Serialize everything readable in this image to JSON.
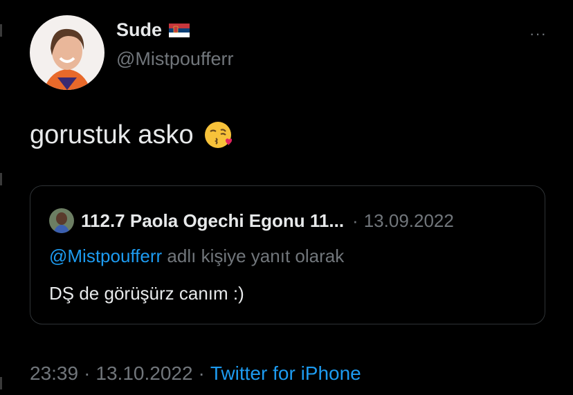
{
  "author": {
    "display_name": "Sude",
    "handle": "@Mistpoufferr",
    "flag_icon": "serbia-flag-icon",
    "more_label": "···"
  },
  "tweet": {
    "text": "gorustuk asko",
    "emoji": "face-blowing-kiss-emoji"
  },
  "quoted_tweet": {
    "author_name": "112.7 Paola Ogechi Egonu 11...",
    "separator": "·",
    "date": "13.09.2022",
    "reply_mention": "@Mistpoufferr",
    "reply_suffix": "adlı kişiye yanıt olarak",
    "text": "DŞ de görüşürz canım :)"
  },
  "meta": {
    "time": "23:39",
    "sep1": "·",
    "date": "13.10.2022",
    "sep2": "·",
    "source": "Twitter for iPhone"
  },
  "colors": {
    "background": "#000000",
    "text": "#e7e9ea",
    "muted": "#71767b",
    "link": "#1d9bf0",
    "border": "#2f3336"
  }
}
